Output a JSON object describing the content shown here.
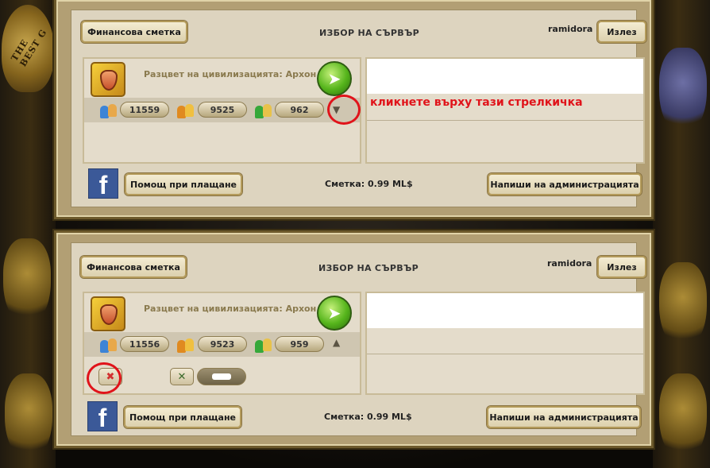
{
  "header": {
    "finance_label": "Финансова сметка",
    "server_select_title": "ИЗБОР НА СЪРВЪР",
    "username": "ramidora",
    "logout_label": "Излез"
  },
  "background": {
    "seal_text": "THE BEST G"
  },
  "server": {
    "name": "Разцвет на цивилизацията: Архон"
  },
  "top_panel": {
    "counts": [
      "11559",
      "9525",
      "962"
    ],
    "annotation": "кликнете върху тази стрелкичка"
  },
  "bottom_panel": {
    "counts": [
      "11556",
      "9523",
      "959"
    ],
    "delete_icon": "✖",
    "toggle_icon": "✕"
  },
  "footer": {
    "facebook_label": "f",
    "payment_help_label": "Помощ при плащане",
    "balance_text": "Сметка: 0.99 ML$",
    "write_admin_label": "Напиши на администрацията"
  },
  "icons": {
    "go": "➤",
    "arrow_down": "▼",
    "arrow_up": "▲"
  },
  "colors": {
    "annotation": "#e0131a",
    "facebook": "#3b5998",
    "go_green": "#56b51c"
  }
}
